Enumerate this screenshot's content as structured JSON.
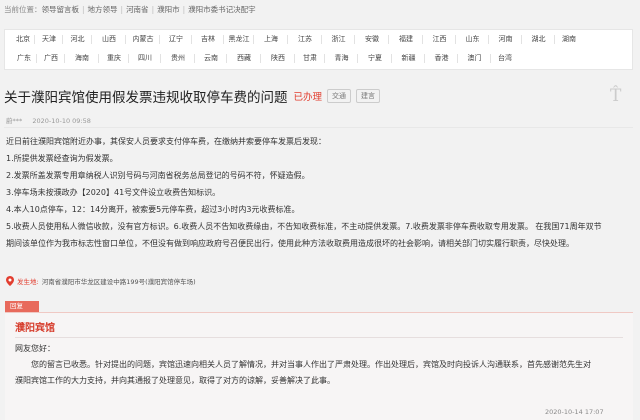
{
  "breadcrumb": {
    "prefix": "当前位置：",
    "items": [
      "领导留言板",
      "地方领导",
      "河南省",
      "濮阳市",
      "濮阳市委书记决配宇"
    ]
  },
  "regions": {
    "row1": [
      "北京",
      "天津",
      "河北",
      "山西",
      "内蒙古",
      "辽宁",
      "吉林",
      "黑龙江",
      "上海",
      "江苏",
      "浙江",
      "安徽",
      "福建",
      "江西",
      "山东",
      "河南",
      "湖北",
      "湖南"
    ],
    "row2": [
      "广东",
      "广西",
      "海南",
      "重庆",
      "四川",
      "贵州",
      "云南",
      "西藏",
      "陕西",
      "甘肃",
      "青海",
      "宁夏",
      "新疆",
      "香港",
      "澳门",
      "台湾"
    ]
  },
  "post": {
    "title": "关于濮阳宾馆使用假发票违规收取停车费的问题",
    "status": "已办理",
    "tags": [
      "交通",
      "建言"
    ],
    "tr_icon": "T̂",
    "author": "蔚***",
    "datetime": "2020-10-10 09:58",
    "lines": [
      "近日前往濮阳宾馆附近办事，其保安人员要求支付停车费，在缴纳并索要停车发票后发现：",
      "1.所提供发票经查询为假发票。",
      "2.发票所盖发票专用章纳税人识别号码与河南省税务总局登记的号码不符，怀疑造假。",
      "3.停车场未按濮政办【2020】41号文件设立收费告知标识。",
      "4.本人10点停车，12：14分离开，被索要5元停车费，超过3小时内3元收费标准。",
      "5.收费人员使用私人微信收款，没有官方标识。6.收费人员不告知收费缘由，不告知收费标准，不主动提供发票。7.收费发票非停车费收取专用发票。 在我国71周年双节",
      "期间该单位作为我市标志性窗口单位，不但没有做到响应政府号召便民出行，使用此种方法收取费用造成很坏的社会影响，请相关部门切实履行职责，尽快处理。"
    ],
    "location_label": "发生地:",
    "location": "河南省濮阳市华龙区建设中路199号(濮阳宾馆停车场)"
  },
  "reply": {
    "tag": "回复",
    "name": "濮阳宾馆",
    "greeting": "网友您好：",
    "lines": [
      "您的留言已收悉。针对提出的问题，宾馆迅速向相关人员了解情况，并对当事人作出了严肃处理。作出处理后，宾馆及时向投诉人沟通联系，首先感谢范先生对",
      "濮阳宾馆工作的大力支持，并向其通报了处理意见，取得了对方的谅解，妥善解决了此事。"
    ],
    "datetime": "2020-10-14 17:07"
  },
  "colors": {
    "accent_red": "#e23d2f",
    "reply_tag_bg": "#e86a5c",
    "page_bg": "#f2f2f2"
  }
}
